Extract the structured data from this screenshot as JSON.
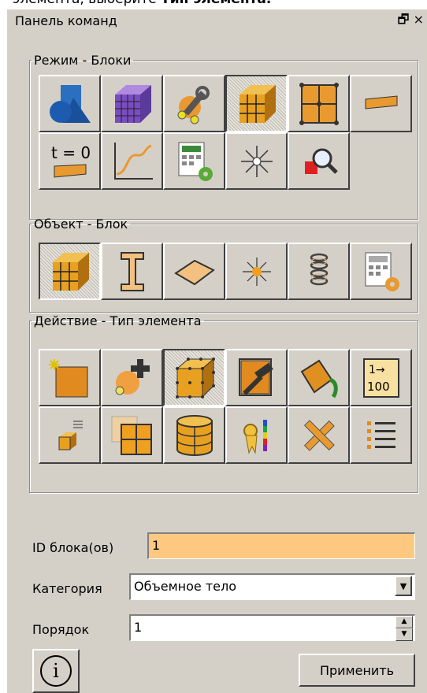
{
  "caption": {
    "text_before": "элемента, выберите ",
    "text_bold": "Тип элемента."
  },
  "panel": {
    "title": "Панель команд",
    "window_buttons": "🗗 ×"
  },
  "groups": [
    {
      "legend": "Режим - Блоки",
      "rows": [
        [
          "geometry-icon",
          "mesh-icon",
          "tools-icon",
          "blocks-icon",
          "grid-icon",
          "boundary-icon"
        ],
        [
          "initial-conditions-icon",
          "curve-graph-icon",
          "calculator-settings-icon",
          "light-icon",
          "probe-icon"
        ]
      ],
      "active": "blocks-icon"
    },
    {
      "legend": "Объект - Блок",
      "rows": [
        [
          "block-cube-icon",
          "beam-icon",
          "shell-icon",
          "point-icon",
          "spring-icon",
          "calculator-settings-icon"
        ]
      ],
      "active": "block-cube-icon"
    },
    {
      "legend": "Действие - Тип элемента",
      "rows": [
        [
          "new-block-icon",
          "add-component-icon",
          "element-type-icon",
          "hammer-icon",
          "paint-bucket-icon",
          "numbering-icon"
        ],
        [
          "small-cube-list-icon",
          "split-block-icon",
          "cylinder-block-icon",
          "ribbon-legend-icon",
          "tools-cross-icon",
          "list-icon"
        ]
      ],
      "active": "element-type-icon"
    }
  ],
  "form": {
    "block_id_label": "ID блока(ов)",
    "block_id_value": "1",
    "category_label": "Категория",
    "category_value": "Объемное тело",
    "order_label": "Порядок",
    "order_value": "1"
  },
  "buttons": {
    "info_label": "i",
    "apply_label": "Применить"
  },
  "colors": {
    "field_highlight": "#ffc880",
    "panel_bg": "#d4d0c8",
    "icon_orange": "#e8a030"
  }
}
